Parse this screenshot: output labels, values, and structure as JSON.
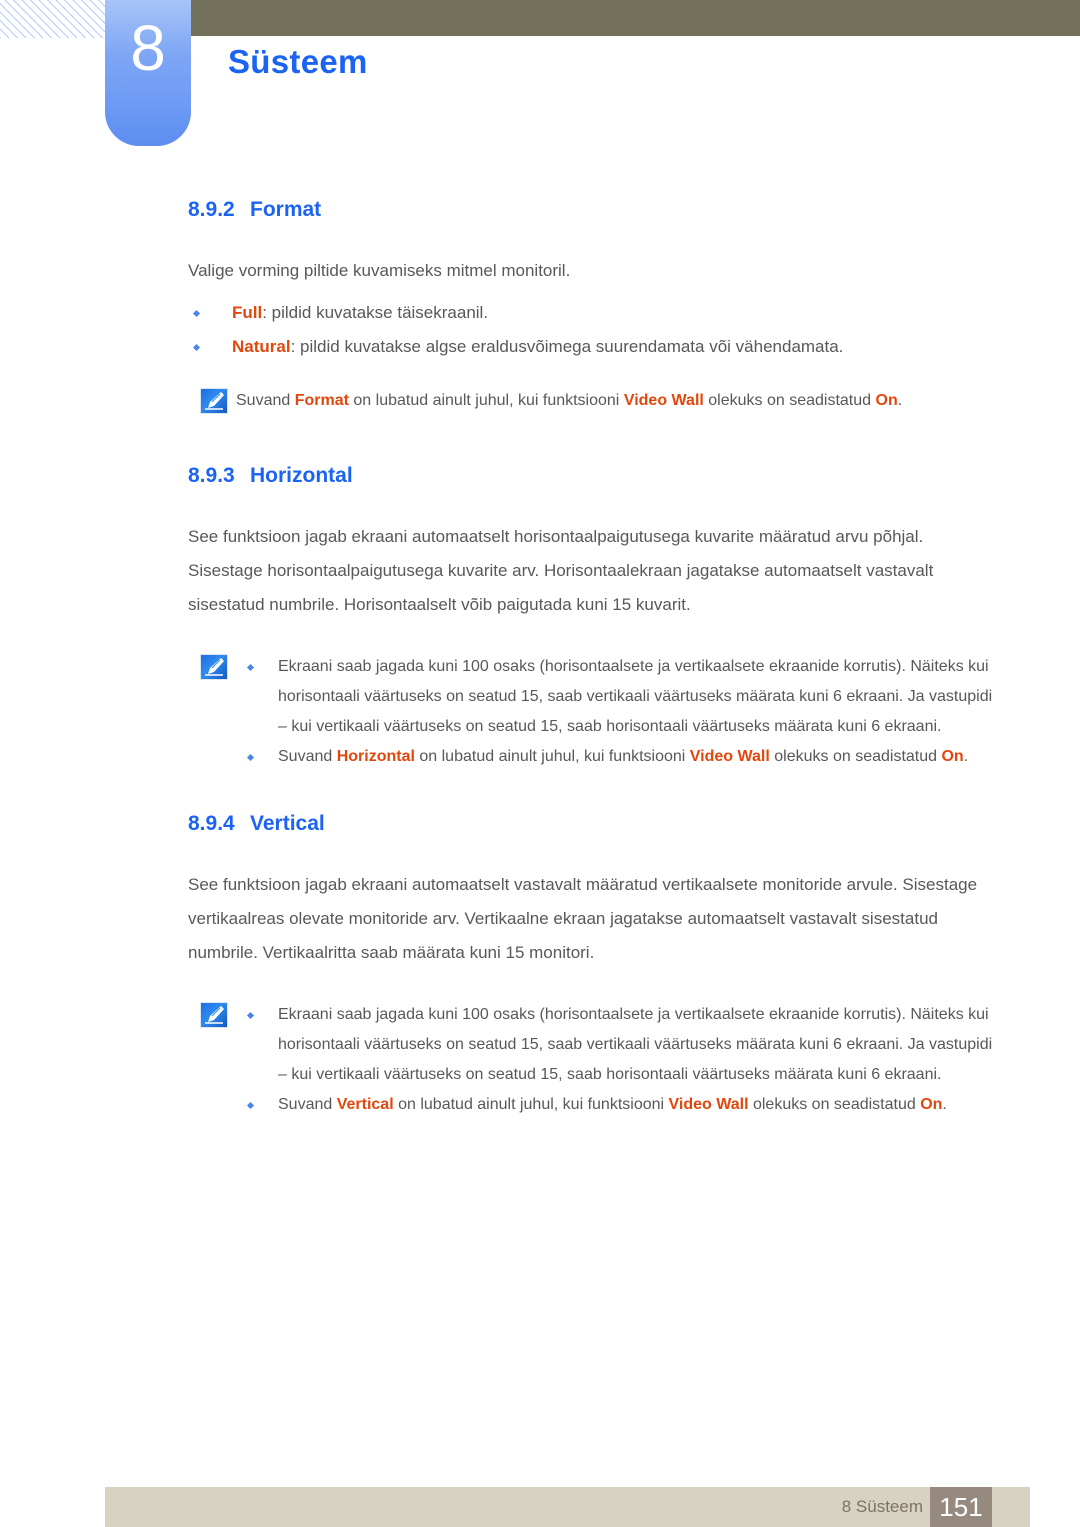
{
  "header": {
    "chapter_number": "8",
    "chapter_title": "Süsteem",
    "hatch_pattern_name": "diagonal-hatch-decoration",
    "accent_blue": "#1b63f2",
    "badge_blue": "#6e9bf4",
    "bar_olive": "#73705c"
  },
  "sections": [
    {
      "number": "8.9.2",
      "title": "Format",
      "intro": "Valige vorming piltide kuvamiseks mitmel monitoril.",
      "bullets": [
        {
          "keyword": "Full",
          "rest": ": pildid kuvatakse täisekraanil."
        },
        {
          "keyword": "Natural",
          "rest": ": pildid kuvatakse algse eraldusvõimega suurendamata või vähendamata."
        }
      ],
      "note": {
        "icon": "note-pen-icon",
        "pre": "Suvand ",
        "kw1": "Format",
        "mid": " on lubatud ainult juhul, kui funktsiooni ",
        "kw2": "Video Wall",
        "mid2": " olekuks on seadistatud ",
        "kw3": "On",
        "end": "."
      }
    },
    {
      "number": "8.9.3",
      "title": "Horizontal",
      "paragraph": "See funktsioon jagab ekraani automaatselt horisontaalpaigutusega kuvarite määratud arvu põhjal. Sisestage horisontaalpaigutusega kuvarite arv. Horisontaalekraan jagatakse automaatselt vastavalt sisestatud numbrile. Horisontaalselt võib paigutada kuni 15 kuvarit.",
      "note": {
        "icon": "note-pen-icon",
        "item1": "Ekraani saab jagada kuni 100 osaks (horisontaalsete ja vertikaalsete ekraanide korrutis). Näiteks kui horisontaali väärtuseks on seatud 15, saab vertikaali väärtuseks määrata kuni 6 ekraani. Ja vastupidi – kui vertikaali väärtuseks on seatud 15, saab horisontaali väärtuseks määrata kuni 6 ekraani.",
        "item2": {
          "pre": "Suvand ",
          "kw1": "Horizontal",
          "mid": " on lubatud ainult juhul, kui funktsiooni ",
          "kw2": "Video Wall",
          "mid2": " olekuks on seadistatud ",
          "kw3": "On",
          "end": "."
        }
      }
    },
    {
      "number": "8.9.4",
      "title": "Vertical",
      "paragraph": "See funktsioon jagab ekraani automaatselt vastavalt määratud vertikaalsete monitoride arvule. Sisestage vertikaalreas olevate monitoride arv. Vertikaalne ekraan jagatakse automaatselt vastavalt sisestatud numbrile. Vertikaalritta saab määrata kuni 15 monitori.",
      "note": {
        "icon": "note-pen-icon",
        "item1": "Ekraani saab jagada kuni 100 osaks (horisontaalsete ja vertikaalsete ekraanide korrutis). Näiteks kui horisontaali väärtuseks on seatud 15, saab vertikaali väärtuseks määrata kuni 6 ekraani. Ja vastupidi – kui vertikaali väärtuseks on seatud 15, saab horisontaali väärtuseks määrata kuni 6 ekraani.",
        "item2": {
          "pre": "Suvand ",
          "kw1": "Vertical",
          "mid": " on lubatud ainult juhul, kui funktsiooni ",
          "kw2": "Video Wall",
          "mid2": " olekuks on seadistatud ",
          "kw3": "On",
          "end": "."
        }
      }
    }
  ],
  "footer": {
    "label": "8 Süsteem",
    "page_number": "151",
    "bar_color": "#d8d3c0",
    "page_box_color": "#968a7e"
  }
}
